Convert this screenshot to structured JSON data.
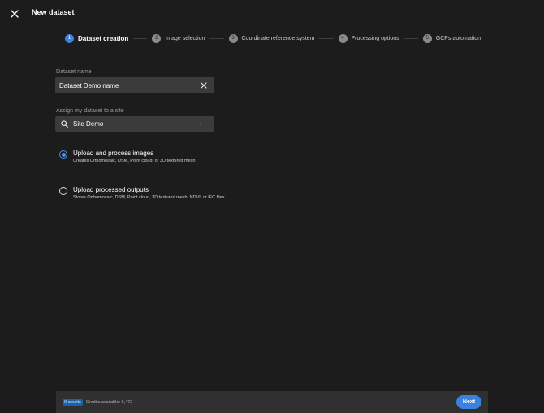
{
  "header": {
    "title": "New dataset",
    "close_icon": "close-icon"
  },
  "stepper": {
    "steps": [
      {
        "number": "1",
        "label": "Dataset creation",
        "active": true
      },
      {
        "number": "2",
        "label": "Image selection",
        "active": false
      },
      {
        "number": "3",
        "label": "Coordinate reference system",
        "active": false
      },
      {
        "number": "4",
        "label": "Processing options",
        "active": false
      },
      {
        "number": "5",
        "label": "GCPs automation",
        "active": false
      }
    ]
  },
  "form": {
    "dataset_name": {
      "label": "Dataset name",
      "value": "Dataset Demo name",
      "clear_icon": "close-icon"
    },
    "site": {
      "label": "Assign my dataset to a site",
      "value": "Site Demo",
      "marker": ".",
      "search_icon": "search-icon"
    },
    "options": [
      {
        "title": "Upload and process images",
        "description": "Creates Orthomosaic, DSM, Point cloud, or 3D textured mesh",
        "selected": true
      },
      {
        "title": "Upload processed outputs",
        "description": "Stores Orthomosaic, DSM, Point cloud, 3D textured mesh, NDVI, or IFC files",
        "selected": false
      }
    ]
  },
  "footer": {
    "credits_badge": "0 credits",
    "credits_available": "Credits available: 6,472",
    "next_label": "Next"
  },
  "colors": {
    "background": "#1c1c1c",
    "accent": "#3b82e0",
    "field_bg": "#3b3b3b",
    "footer_bg": "#303030"
  }
}
